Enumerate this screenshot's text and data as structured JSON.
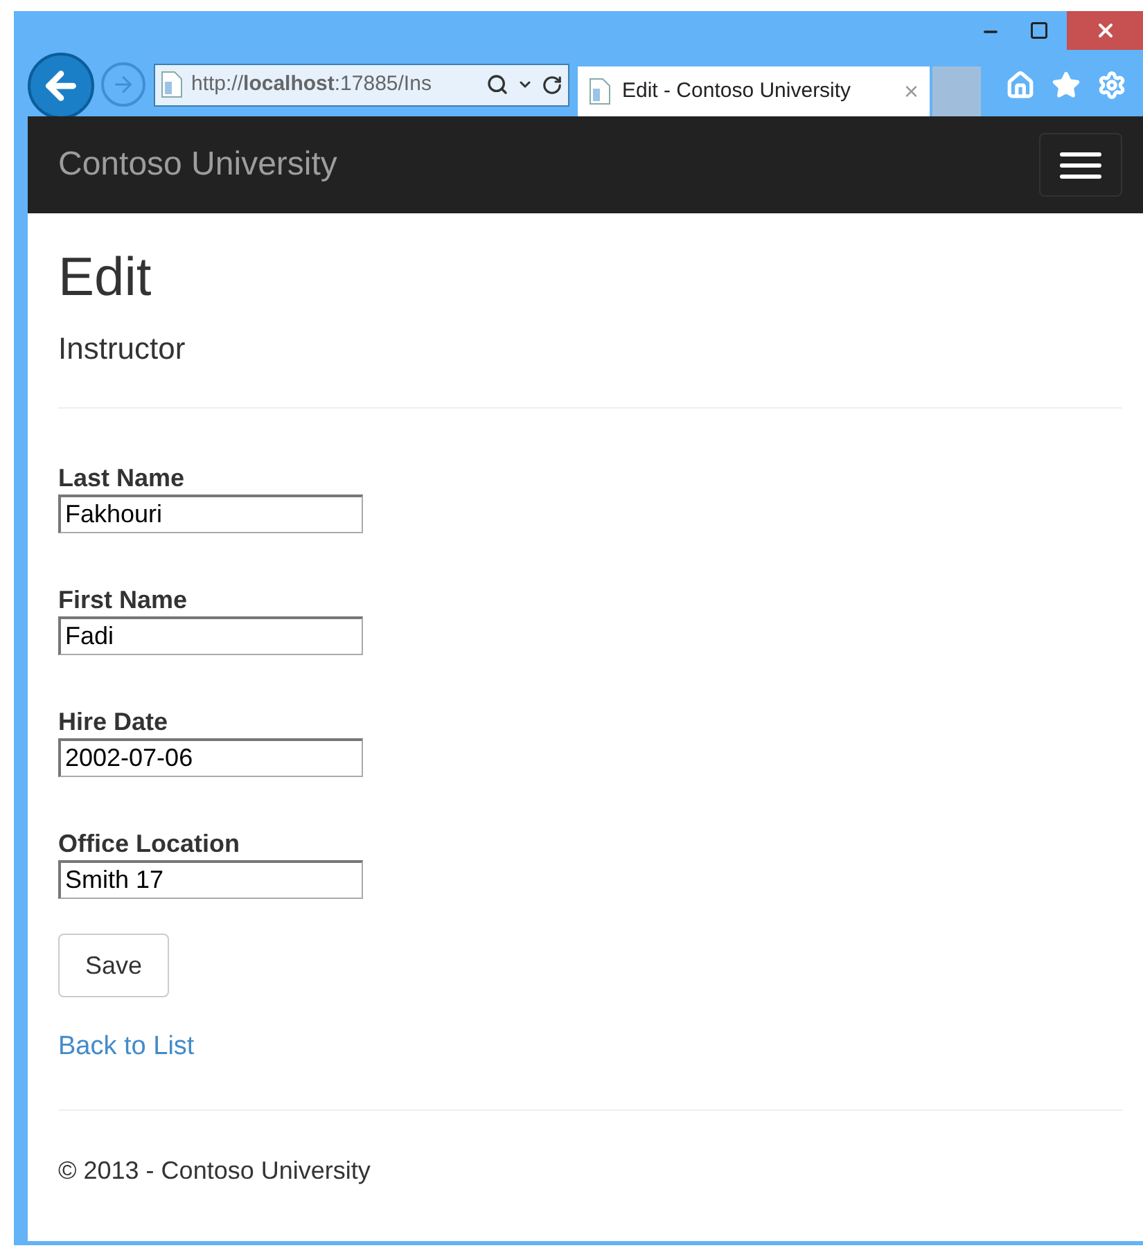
{
  "browser": {
    "address": "http://**localhost**:17885/Ins",
    "tab": {
      "title": "Edit - Contoso University",
      "close": "×"
    }
  },
  "navbar": {
    "brand": "Contoso University"
  },
  "page": {
    "title": "Edit",
    "subtitle": "Instructor"
  },
  "fields": [
    {
      "label": "Last Name",
      "value": "Fakhouri"
    },
    {
      "label": "First Name",
      "value": "Fadi"
    },
    {
      "label": "Hire Date",
      "value": "2002-07-06"
    },
    {
      "label": "Office Location",
      "value": "Smith 17"
    }
  ],
  "save_button": "Save",
  "back_link": "Back to List",
  "footer": "© 2013 - Contoso University"
}
